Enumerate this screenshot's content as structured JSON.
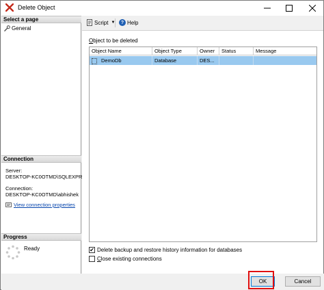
{
  "window": {
    "title": "Delete Object",
    "minimize_glyph": "—",
    "maximize_glyph": "☐",
    "close_glyph": "✕"
  },
  "sidebar": {
    "select_page_header": "Select a page",
    "pages": [
      {
        "label": "General",
        "icon": "wrench-icon"
      }
    ],
    "connection_header": "Connection",
    "server_label": "Server:",
    "server_value": "DESKTOP-KC0OTMD\\SQLEXPR",
    "connection_label": "Connection:",
    "connection_value": "DESKTOP-KC0OTMD\\abhishek",
    "view_properties_link": "View connection properties",
    "progress_header": "Progress",
    "progress_status": "Ready"
  },
  "toolbar": {
    "script_label": "Script",
    "help_label": "Help"
  },
  "main": {
    "object_label_underline": "O",
    "object_label_rest": "bject to be deleted",
    "columns": [
      "Object Name",
      "Object Type",
      "Owner",
      "Status",
      "Message"
    ],
    "rows": [
      {
        "object_name": "DemoDb",
        "object_type": "Database",
        "owner": "DES...",
        "status": "",
        "message": ""
      }
    ],
    "option_delete_backup": {
      "checked": true,
      "label": "Delete backup and restore history information for databases"
    },
    "option_close_connections": {
      "checked": false,
      "label_underline": "C",
      "label_rest": "lose existing connections"
    }
  },
  "buttons": {
    "ok_label": "OK",
    "cancel_label": "Cancel"
  },
  "colors": {
    "selection": "#99c9ef",
    "link": "#0645ad",
    "highlight": "#e01010",
    "title_icon": "#c42b1c"
  }
}
